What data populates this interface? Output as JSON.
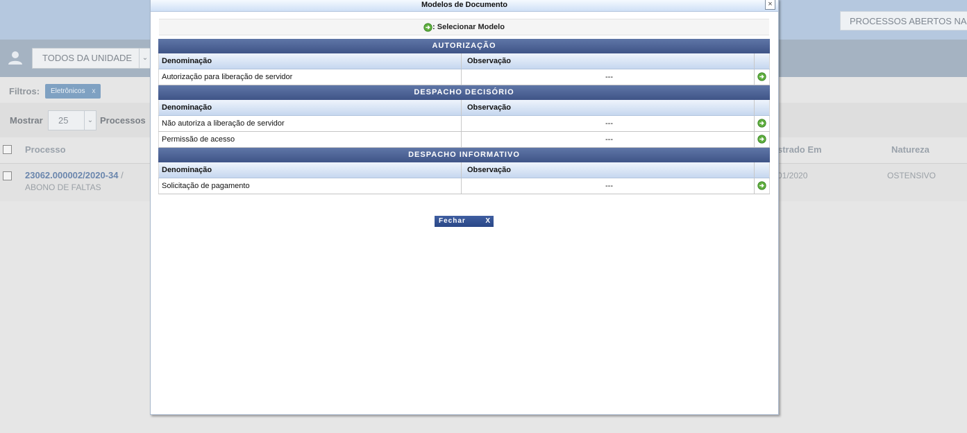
{
  "background": {
    "top_button": "PROCESSOS ABERTOS NA U",
    "unidade_select": "TODOS DA UNIDADE",
    "filtros_label": "Filtros:",
    "filter_chip": "Eletrônicos",
    "filter_chip_remove": "x",
    "mostrar_label": "Mostrar",
    "mostrar_value": "25",
    "processos_label": "Processos",
    "columns": {
      "processo": "Processo",
      "cadastrado_em": "strado Em",
      "natureza": "Natureza"
    },
    "row": {
      "numero": "23062.000002/2020-34",
      "separator": "/",
      "assunto": "ABONO DE FALTAS",
      "data": "01/2020",
      "natureza": "OSTENSIVO"
    }
  },
  "modal": {
    "title": "Modelos de Documento",
    "close_label": "×",
    "legend": ": Selecionar Modelo",
    "column_denominacao": "Denominação",
    "column_observacao": "Observação",
    "sections": [
      {
        "title": "AUTORIZAÇÃO",
        "rows": [
          {
            "denominacao": "Autorização para liberação de servidor",
            "observacao": "---"
          }
        ]
      },
      {
        "title": "DESPACHO DECISÓRIO",
        "rows": [
          {
            "denominacao": "Não autoriza a liberação de servidor",
            "observacao": "---"
          },
          {
            "denominacao": "Permissão de acesso",
            "observacao": "---"
          }
        ]
      },
      {
        "title": "DESPACHO INFORMATIVO",
        "rows": [
          {
            "denominacao": "Solicitação de pagamento",
            "observacao": "---"
          }
        ]
      }
    ],
    "fechar_label": "Fechar",
    "fechar_x": "X"
  },
  "colors": {
    "section_header": "#4a6094",
    "link_blue": "#6a86ad",
    "top_band": "#b5c8df"
  }
}
